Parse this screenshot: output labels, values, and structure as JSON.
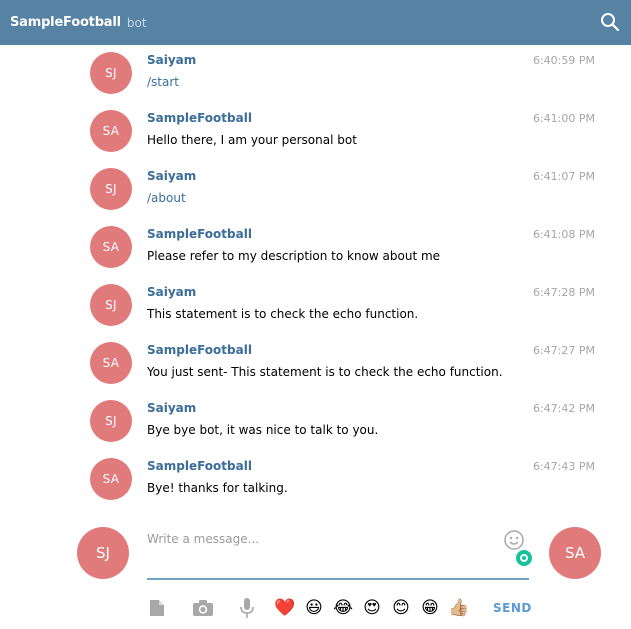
{
  "header": {
    "title": "SampleFootball",
    "subtitle": "bot",
    "search_icon": "search-icon"
  },
  "messages": [
    {
      "initials": "SJ",
      "author": "Saiyam",
      "time": "6:40:59 PM",
      "text": "/start",
      "is_command": true
    },
    {
      "initials": "SA",
      "author": "SampleFootball",
      "time": "6:41:00 PM",
      "text": "Hello there, I am your personal bot",
      "is_command": false
    },
    {
      "initials": "SJ",
      "author": "Saiyam",
      "time": "6:41:07 PM",
      "text": "/about",
      "is_command": true
    },
    {
      "initials": "SA",
      "author": "SampleFootball",
      "time": "6:41:08 PM",
      "text": "Please refer to my description to know about me",
      "is_command": false
    },
    {
      "initials": "SJ",
      "author": "Saiyam",
      "time": "6:47:28 PM",
      "text": "This statement is to check the echo function.",
      "is_command": false
    },
    {
      "initials": "SA",
      "author": "SampleFootball",
      "time": "6:47:27 PM",
      "text": "You just sent- This statement is to check the echo function.",
      "is_command": false
    },
    {
      "initials": "SJ",
      "author": "Saiyam",
      "time": "6:47:42 PM",
      "text": "Bye bye bot, it was nice to talk to you.",
      "is_command": false
    },
    {
      "initials": "SA",
      "author": "SampleFootball",
      "time": "6:47:43 PM",
      "text": "Bye! thanks for talking.",
      "is_command": false
    }
  ],
  "composer": {
    "user_initials": "SJ",
    "peer_initials": "SA",
    "placeholder": "Write a message...",
    "value": "",
    "send_label": "SEND"
  },
  "toolbar": {
    "tools": [
      "attach-file-icon",
      "camera-icon",
      "microphone-icon"
    ],
    "emojis": [
      "❤️",
      "😃",
      "😂",
      "😍",
      "😊",
      "😁",
      "👍🏼"
    ]
  },
  "colors": {
    "header_bg": "#5682a3",
    "avatar_bg": "#e17a7a",
    "author": "#3a6d99",
    "accent": "#6ea3c6"
  }
}
